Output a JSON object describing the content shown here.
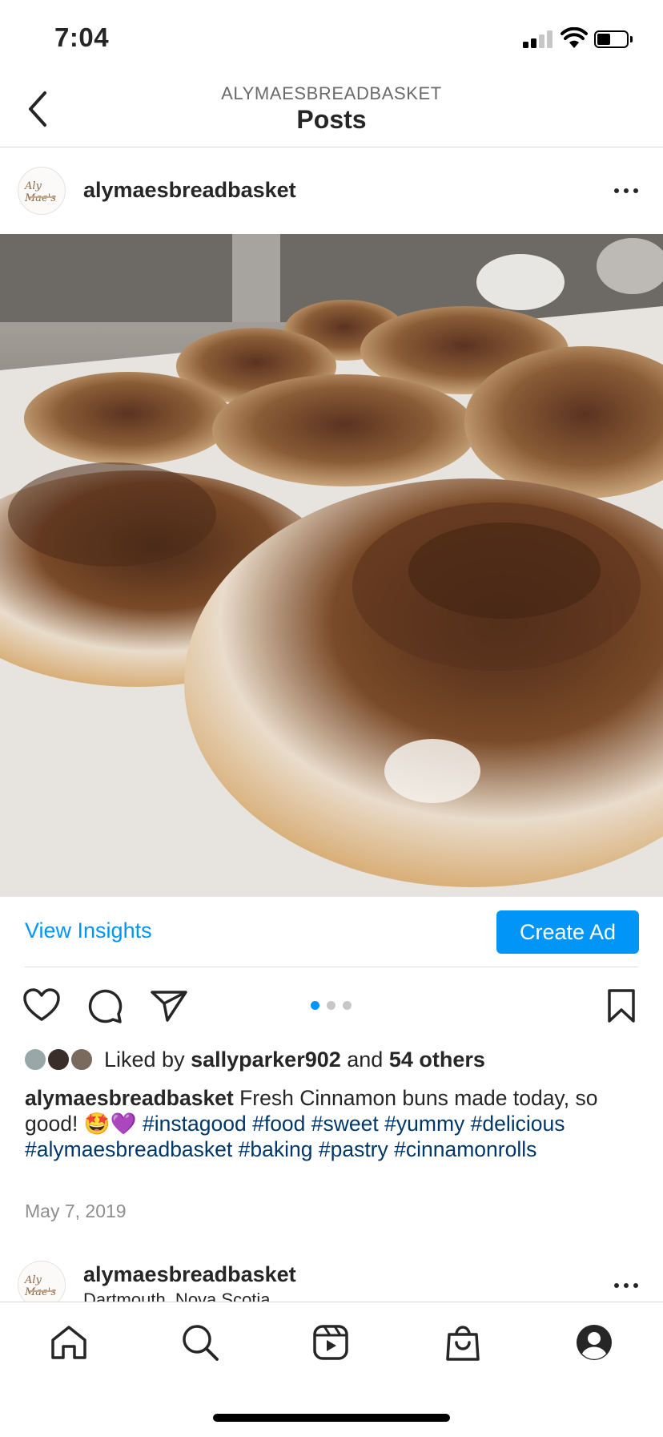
{
  "status_bar": {
    "time": "7:04"
  },
  "header": {
    "account": "ALYMAESBREADBASKET",
    "title": "Posts"
  },
  "post": {
    "username": "alymaesbreadbasket",
    "avatar_logo_text": "Aly Mae's",
    "image_description": "Tray of freshly glazed cinnamon buns",
    "actions": {
      "view_insights": "View Insights",
      "create_ad": "Create Ad"
    },
    "carousel": {
      "count": 3,
      "active": 0
    },
    "likes": {
      "prefix": "Liked by",
      "user": "sallyparker902",
      "joiner": "and",
      "others": "54 others"
    },
    "caption": {
      "user": "alymaesbreadbasket",
      "text": "Fresh Cinnamon buns made today, so good! 🤩💜",
      "hashtags": [
        "#instagood",
        "#food",
        "#sweet",
        "#yummy",
        "#delicious",
        "#alymaesbreadbasket",
        "#baking",
        "#pastry",
        "#cinnamonrolls"
      ]
    },
    "date": "May 7, 2019"
  },
  "next_post": {
    "username": "alymaesbreadbasket",
    "location": "Dartmouth, Nova Scotia"
  },
  "tabs": [
    "home-tab",
    "search-tab",
    "reels-tab",
    "shop-tab",
    "profile-tab"
  ],
  "colors": {
    "accent": "#0095f6",
    "hashtag": "#00376b",
    "text": "#262626",
    "muted": "#8e8e8e"
  }
}
